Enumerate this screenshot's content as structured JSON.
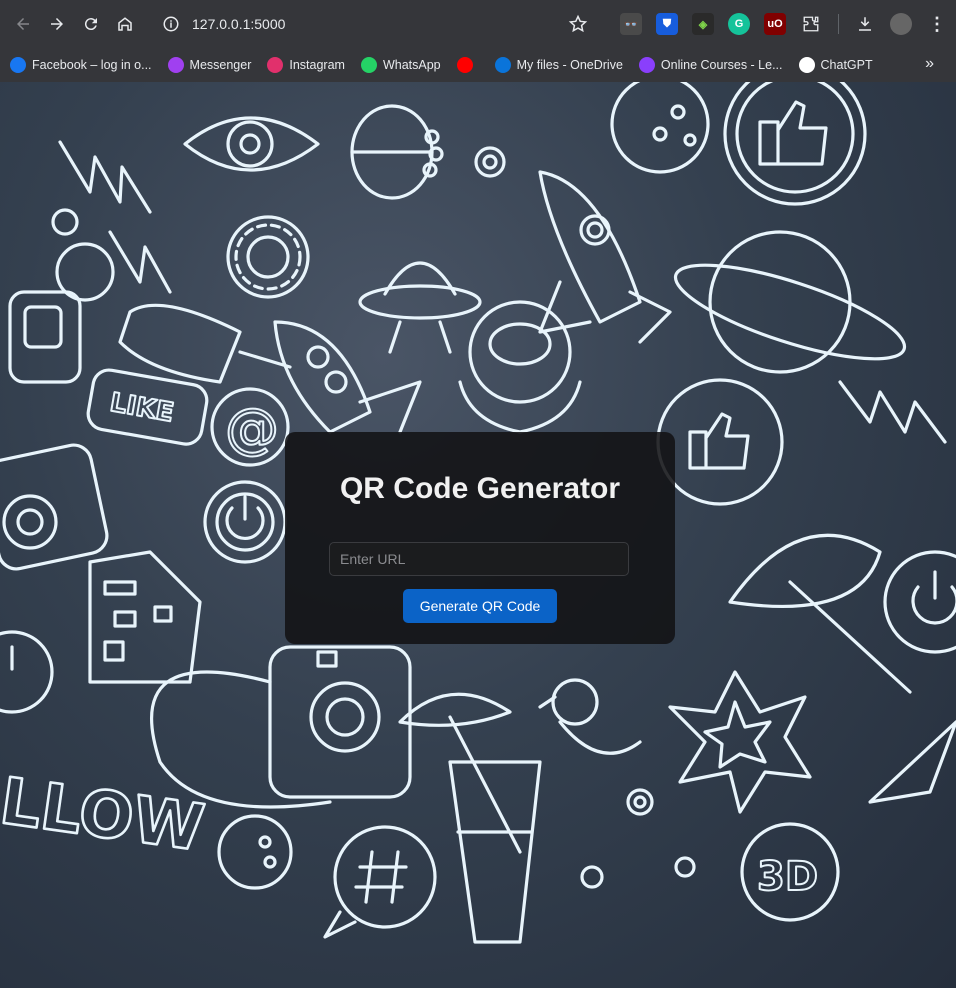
{
  "browser": {
    "url": "127.0.0.1:5000",
    "bookmarks": [
      {
        "label": "Facebook – log in o...",
        "icon": "facebook-icon",
        "color": "#1877f2"
      },
      {
        "label": "Messenger",
        "icon": "messenger-icon",
        "color": "#a040f0"
      },
      {
        "label": "Instagram",
        "icon": "instagram-icon",
        "color": "#e1306c"
      },
      {
        "label": "WhatsApp",
        "icon": "whatsapp-icon",
        "color": "#25d366"
      },
      {
        "label": "",
        "icon": "youtube-icon",
        "color": "#ff0000"
      },
      {
        "label": "My files - OneDrive",
        "icon": "onedrive-icon",
        "color": "#0a74da"
      },
      {
        "label": "Online Courses - Le...",
        "icon": "udemy-icon",
        "color": "#8a3ffc"
      },
      {
        "label": "ChatGPT",
        "icon": "chatgpt-icon",
        "color": "#ffffff"
      }
    ],
    "more_bookmarks": "»"
  },
  "app": {
    "title": "QR Code Generator",
    "input_placeholder": "Enter URL",
    "input_value": "",
    "button_label": "Generate QR Code",
    "accent_color": "#0b63c7"
  }
}
